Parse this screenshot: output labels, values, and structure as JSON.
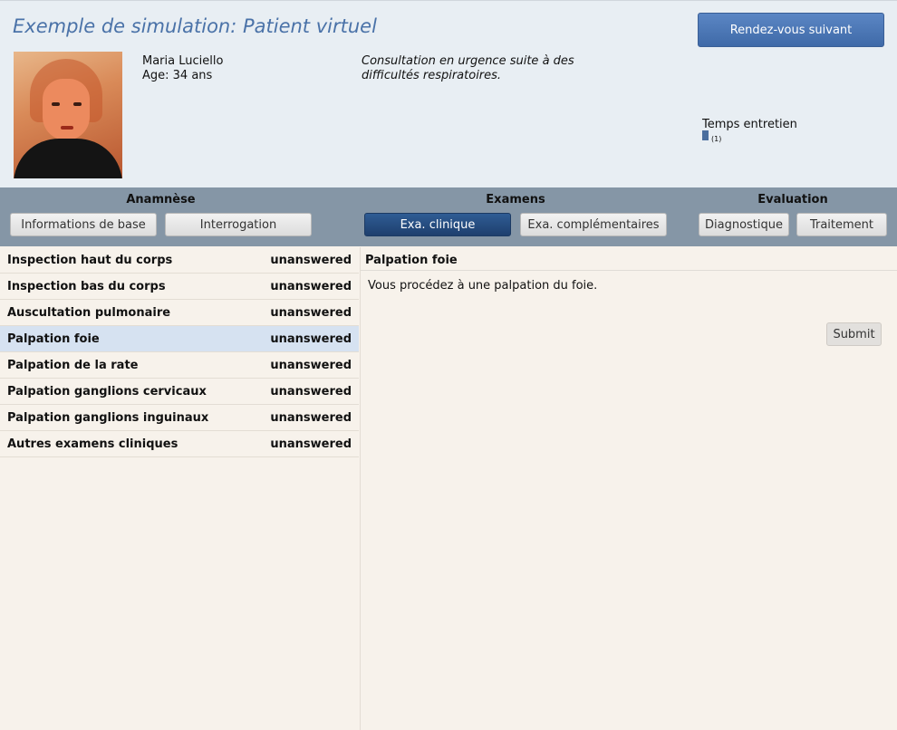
{
  "header": {
    "title": "Exemple de simulation: Patient virtuel",
    "next_button": "Rendez-vous suivant",
    "patient_name": "Maria Luciello",
    "patient_age": "Age: 34 ans",
    "reason": "Consultation en urgence suite à des difficultés respiratoires.",
    "time_label": "Temps entretien",
    "time_count": "(1)"
  },
  "tabs": {
    "anamnese": {
      "label": "Anamnèse",
      "items": [
        "Informations de base",
        "Interrogation"
      ]
    },
    "examens": {
      "label": "Examens",
      "items": [
        "Exa. clinique",
        "Exa. complémentaires"
      ]
    },
    "evaluation": {
      "label": "Evaluation",
      "items": [
        "Diagnostique",
        "Traitement"
      ]
    },
    "active": "Exa. clinique"
  },
  "questions": [
    {
      "label": "Inspection haut du corps",
      "status": "unanswered"
    },
    {
      "label": "Inspection bas du corps",
      "status": "unanswered"
    },
    {
      "label": "Auscultation pulmonaire",
      "status": "unanswered"
    },
    {
      "label": "Palpation foie",
      "status": "unanswered",
      "selected": true
    },
    {
      "label": "Palpation de la rate",
      "status": "unanswered"
    },
    {
      "label": "Palpation ganglions cervicaux",
      "status": "unanswered"
    },
    {
      "label": "Palpation ganglions inguinaux",
      "status": "unanswered"
    },
    {
      "label": "Autres examens cliniques",
      "status": "unanswered"
    }
  ],
  "detail": {
    "title": "Palpation foie",
    "text": "Vous procédez à une palpation du foie.",
    "submit": "Submit"
  },
  "colors": {
    "title": "#4a72a8",
    "header_bg": "#e8eef3",
    "tabbar_bg": "#8596a6",
    "active_tab": "#1e3f6e",
    "selected_row": "#d6e2f1",
    "page_bg": "#f7f2eb"
  }
}
